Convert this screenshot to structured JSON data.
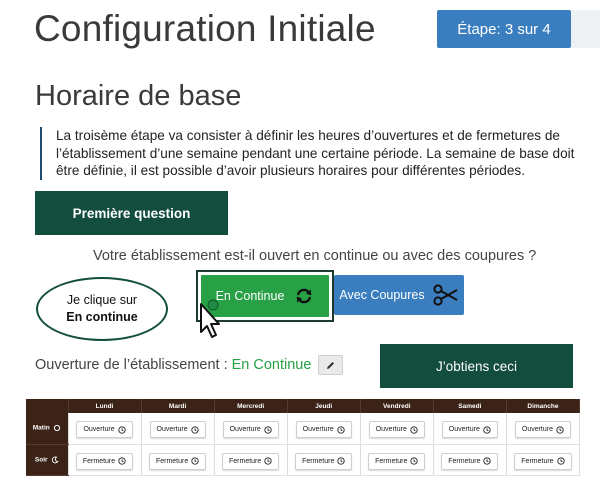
{
  "header": {
    "title": "Configuration Initiale",
    "step_label": "Étape: 3 sur 4"
  },
  "section": {
    "title": "Horaire de base",
    "description": "La troisème étape va consister à définir les heures d’ouvertures et de fermetures de l’établissement d’une semaine pendant une certaine période. La semaine de base doit être définie, il est possible d’avoir plusieurs horaires pour différentes périodes."
  },
  "callouts": {
    "first_question": "Première question",
    "result": "J’obtiens ceci",
    "bubble_line1": "Je clique sur",
    "bubble_line2": "En continue"
  },
  "question": {
    "text": "Votre établissement est-il ouvert en continue ou avec des coupures ?",
    "option_continue": "En Continue",
    "option_cuts": "Avec Coupures",
    "option_continue_icon": "refresh-icon",
    "option_cuts_icon": "scissors-icon"
  },
  "opening": {
    "label": "Ouverture de l’établissement :",
    "value": "En Continue"
  },
  "schedule": {
    "days": [
      "Lundi",
      "Mardi",
      "Mercredi",
      "Jeudi",
      "Vendredi",
      "Samedi",
      "Dimanche"
    ],
    "rows": [
      {
        "label": "Matin",
        "icon": "sun-icon",
        "button": "Ouverture",
        "button_icon": "clock-icon"
      },
      {
        "label": "Soir",
        "icon": "moon-icon",
        "button": "Fermeture",
        "button_icon": "clock-icon"
      }
    ]
  },
  "colors": {
    "step_badge": "#3a7ebf",
    "dark_green": "#134d3d",
    "continue_green": "#27a046",
    "cuts_blue": "#3a7ebf",
    "table_header": "#3b2318"
  }
}
